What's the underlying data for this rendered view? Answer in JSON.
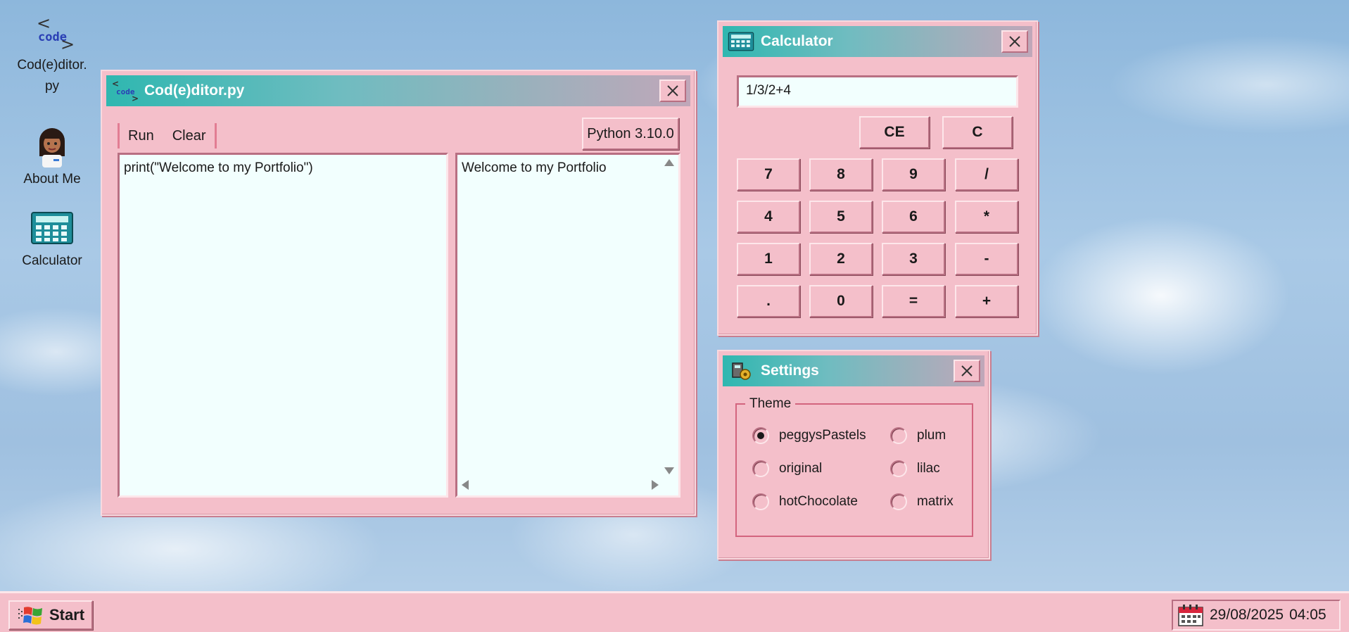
{
  "desktop": {
    "icons": [
      {
        "label": "Cod(e)ditor.\npy",
        "icon": "code-icon"
      },
      {
        "label": "About Me",
        "icon": "avatar-icon"
      },
      {
        "label": "Calculator",
        "icon": "calculator-icon"
      }
    ],
    "code_logo_text": "code"
  },
  "editor": {
    "title": "Cod(e)ditor.py",
    "run_label": "Run",
    "clear_label": "Clear",
    "python_version": "Python 3.10.0",
    "code": "print(\"Welcome to my Portfolio\")",
    "output": "Welcome to my Portfolio"
  },
  "calculator": {
    "title": "Calculator",
    "display": "1/3/2+4",
    "keys": {
      "ce": "CE",
      "c": "C",
      "k7": "7",
      "k8": "8",
      "k9": "9",
      "div": "/",
      "k4": "4",
      "k5": "5",
      "k6": "6",
      "mul": "*",
      "k1": "1",
      "k2": "2",
      "k3": "3",
      "sub": "-",
      "dot": ".",
      "k0": "0",
      "eq": "=",
      "add": "+"
    }
  },
  "settings": {
    "title": "Settings",
    "theme_legend": "Theme",
    "themes": [
      {
        "label": "peggysPastels",
        "checked": true
      },
      {
        "label": "plum",
        "checked": false
      },
      {
        "label": "original",
        "checked": false
      },
      {
        "label": "lilac",
        "checked": false
      },
      {
        "label": "hotChocolate",
        "checked": false
      },
      {
        "label": "matrix",
        "checked": false
      }
    ]
  },
  "taskbar": {
    "start_label": "Start",
    "date": "29/08/2025",
    "time": "04:05"
  },
  "colors": {
    "window_bg": "#f4bfca",
    "titlebar_start": "#2fb7b0",
    "titlebar_end": "#c0a7b9",
    "pane_bg": "#f2fffe",
    "accent_border": "#d3647e"
  }
}
